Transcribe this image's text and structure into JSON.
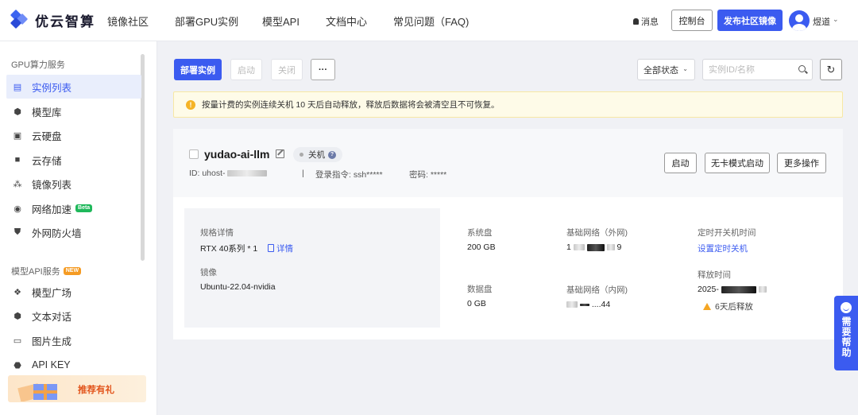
{
  "brand": {
    "name": "优云智算"
  },
  "topnav": {
    "links": [
      "镜像社区",
      "部署GPU实例",
      "模型API",
      "文档中心",
      "常见问题（FAQ)"
    ],
    "message": "消息",
    "console": "控制台",
    "publish": "发布社区镜像",
    "username": "煜道"
  },
  "sidebar": {
    "section1": "GPU算力服务",
    "items1": [
      "实例列表",
      "模型库",
      "云硬盘",
      "云存储",
      "镜像列表",
      "网络加速",
      "外网防火墙"
    ],
    "beta": "Beta",
    "section2": "模型API服务",
    "new": "NEW",
    "items2": [
      "模型广场",
      "文本对话",
      "图片生成",
      "API KEY"
    ],
    "promo": "推荐有礼"
  },
  "toolbar": {
    "deploy": "部署实例",
    "start": "启动",
    "close": "关闭",
    "more": "···",
    "status": "全部状态",
    "search_placeholder": "实例ID/名称"
  },
  "alert": "按量计费的实例连续关机 10 天后自动释放，释放后数据将会被清空且不可恢复。",
  "instance": {
    "name": "yudao-ai-llm",
    "state": "关机",
    "id_prefix": "ID: uhost-",
    "login": "登录指令: ssh*****",
    "password": "密码: *****",
    "actions": [
      "启动",
      "无卡模式启动",
      "更多操作"
    ],
    "spec_label": "规格详情",
    "spec_value": "RTX 40系列 * 1",
    "spec_link": "详情",
    "image_label": "镜像",
    "image_value": "Ubuntu-22.04-nvidia",
    "sys_disk_label": "系统盘",
    "sys_disk_value": "200 GB",
    "data_disk_label": "数据盘",
    "data_disk_value": "0 GB",
    "net_ext_label": "基础网络（外网)",
    "net_ext_prefix": "1",
    "net_ext_suffix": "9",
    "net_int_label": "基础网络（内网)",
    "net_int_suffix": "44",
    "timer_label": "定时开关机时间",
    "timer_link": "设置定时关机",
    "release_label": "释放时间",
    "release_prefix": "2025-",
    "release_warn": "6天后释放"
  },
  "help": "需要帮助",
  "colors": {
    "accent": "#3b5bf0",
    "warning": "#f5a623"
  }
}
